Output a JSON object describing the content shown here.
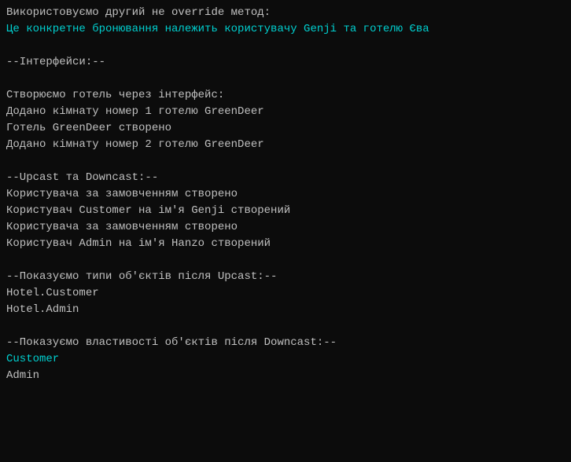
{
  "terminal": {
    "lines": [
      {
        "id": "line1",
        "text": "Використовуємо другий не override метод:",
        "color": "white"
      },
      {
        "id": "line2",
        "text": "Це конкретне бронювання належить користувачу Genji та готелю Єва",
        "color": "cyan"
      },
      {
        "id": "line3",
        "text": "",
        "color": "white"
      },
      {
        "id": "line4",
        "text": "--Інтерфейси:--",
        "color": "white"
      },
      {
        "id": "line5",
        "text": "",
        "color": "white"
      },
      {
        "id": "line6",
        "text": "Створюємо готель через інтерфейс:",
        "color": "white"
      },
      {
        "id": "line7",
        "text": "Додано кімнату номер 1 готелю GreenDeer",
        "color": "white"
      },
      {
        "id": "line8",
        "text": "Готель GreenDeer створено",
        "color": "white"
      },
      {
        "id": "line9",
        "text": "Додано кімнату номер 2 готелю GreenDeer",
        "color": "white"
      },
      {
        "id": "line10",
        "text": "",
        "color": "white"
      },
      {
        "id": "line11",
        "text": "--Upcast та Downcast:--",
        "color": "white"
      },
      {
        "id": "line12",
        "text": "Користувача за замовченням створено",
        "color": "white"
      },
      {
        "id": "line13",
        "text": "Користувач Customer на ім'я Genji створений",
        "color": "white"
      },
      {
        "id": "line14",
        "text": "Користувача за замовченням створено",
        "color": "white"
      },
      {
        "id": "line15",
        "text": "Користувач Admin на ім'я Hanzo створений",
        "color": "white"
      },
      {
        "id": "line16",
        "text": "",
        "color": "white"
      },
      {
        "id": "line17",
        "text": "--Показуємо типи об'єктів після Upcast:--",
        "color": "white"
      },
      {
        "id": "line18",
        "text": "Hotel.Customer",
        "color": "white"
      },
      {
        "id": "line19",
        "text": "Hotel.Admin",
        "color": "white"
      },
      {
        "id": "line20",
        "text": "",
        "color": "white"
      },
      {
        "id": "line21",
        "text": "--Показуємо властивості об'єктів після Downcast:--",
        "color": "white"
      },
      {
        "id": "line22",
        "text": "Customer",
        "color": "cyan"
      },
      {
        "id": "line23",
        "text": "Admin",
        "color": "white"
      }
    ]
  }
}
